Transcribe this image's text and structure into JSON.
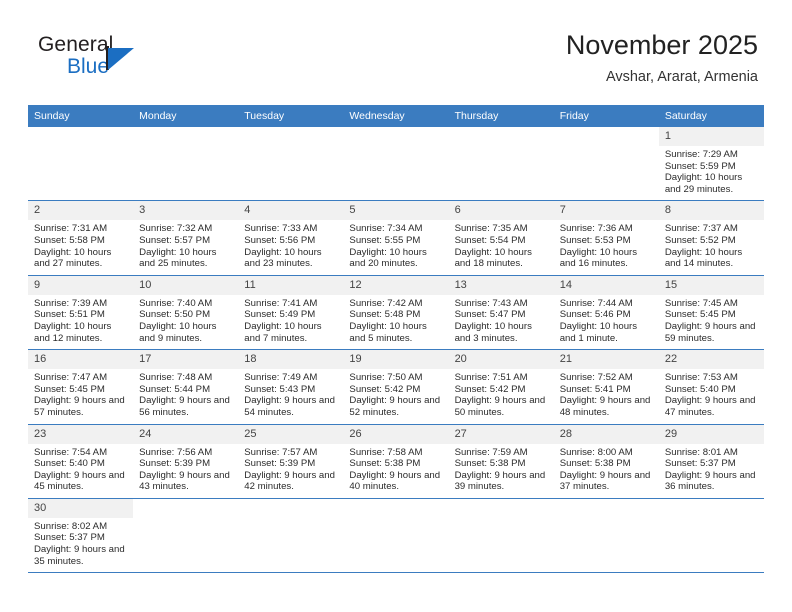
{
  "brand": {
    "line1": "General",
    "line2": "Blue",
    "mark": "triangle-logo"
  },
  "header": {
    "title": "November 2025",
    "subtitle": "Avshar, Ararat, Armenia"
  },
  "weekday_headers": [
    "Sunday",
    "Monday",
    "Tuesday",
    "Wednesday",
    "Thursday",
    "Friday",
    "Saturday"
  ],
  "labels": {
    "sunrise": "Sunrise:",
    "sunset": "Sunset:",
    "daylight": "Daylight:"
  },
  "colors": {
    "header_blue": "#3b7cc0",
    "brand_blue": "#1b6ec2",
    "daynum_bg": "#f1f1f1",
    "text": "#2b2b2b"
  },
  "weeks": [
    [
      {
        "empty": true
      },
      {
        "empty": true
      },
      {
        "empty": true
      },
      {
        "empty": true
      },
      {
        "empty": true
      },
      {
        "empty": true
      },
      {
        "day": "1",
        "sunrise": "Sunrise: 7:29 AM",
        "sunset": "Sunset: 5:59 PM",
        "daylight": "Daylight: 10 hours and 29 minutes."
      }
    ],
    [
      {
        "day": "2",
        "sunrise": "Sunrise: 7:31 AM",
        "sunset": "Sunset: 5:58 PM",
        "daylight": "Daylight: 10 hours and 27 minutes."
      },
      {
        "day": "3",
        "sunrise": "Sunrise: 7:32 AM",
        "sunset": "Sunset: 5:57 PM",
        "daylight": "Daylight: 10 hours and 25 minutes."
      },
      {
        "day": "4",
        "sunrise": "Sunrise: 7:33 AM",
        "sunset": "Sunset: 5:56 PM",
        "daylight": "Daylight: 10 hours and 23 minutes."
      },
      {
        "day": "5",
        "sunrise": "Sunrise: 7:34 AM",
        "sunset": "Sunset: 5:55 PM",
        "daylight": "Daylight: 10 hours and 20 minutes."
      },
      {
        "day": "6",
        "sunrise": "Sunrise: 7:35 AM",
        "sunset": "Sunset: 5:54 PM",
        "daylight": "Daylight: 10 hours and 18 minutes."
      },
      {
        "day": "7",
        "sunrise": "Sunrise: 7:36 AM",
        "sunset": "Sunset: 5:53 PM",
        "daylight": "Daylight: 10 hours and 16 minutes."
      },
      {
        "day": "8",
        "sunrise": "Sunrise: 7:37 AM",
        "sunset": "Sunset: 5:52 PM",
        "daylight": "Daylight: 10 hours and 14 minutes."
      }
    ],
    [
      {
        "day": "9",
        "sunrise": "Sunrise: 7:39 AM",
        "sunset": "Sunset: 5:51 PM",
        "daylight": "Daylight: 10 hours and 12 minutes."
      },
      {
        "day": "10",
        "sunrise": "Sunrise: 7:40 AM",
        "sunset": "Sunset: 5:50 PM",
        "daylight": "Daylight: 10 hours and 9 minutes."
      },
      {
        "day": "11",
        "sunrise": "Sunrise: 7:41 AM",
        "sunset": "Sunset: 5:49 PM",
        "daylight": "Daylight: 10 hours and 7 minutes."
      },
      {
        "day": "12",
        "sunrise": "Sunrise: 7:42 AM",
        "sunset": "Sunset: 5:48 PM",
        "daylight": "Daylight: 10 hours and 5 minutes."
      },
      {
        "day": "13",
        "sunrise": "Sunrise: 7:43 AM",
        "sunset": "Sunset: 5:47 PM",
        "daylight": "Daylight: 10 hours and 3 minutes."
      },
      {
        "day": "14",
        "sunrise": "Sunrise: 7:44 AM",
        "sunset": "Sunset: 5:46 PM",
        "daylight": "Daylight: 10 hours and 1 minute."
      },
      {
        "day": "15",
        "sunrise": "Sunrise: 7:45 AM",
        "sunset": "Sunset: 5:45 PM",
        "daylight": "Daylight: 9 hours and 59 minutes."
      }
    ],
    [
      {
        "day": "16",
        "sunrise": "Sunrise: 7:47 AM",
        "sunset": "Sunset: 5:45 PM",
        "daylight": "Daylight: 9 hours and 57 minutes."
      },
      {
        "day": "17",
        "sunrise": "Sunrise: 7:48 AM",
        "sunset": "Sunset: 5:44 PM",
        "daylight": "Daylight: 9 hours and 56 minutes."
      },
      {
        "day": "18",
        "sunrise": "Sunrise: 7:49 AM",
        "sunset": "Sunset: 5:43 PM",
        "daylight": "Daylight: 9 hours and 54 minutes."
      },
      {
        "day": "19",
        "sunrise": "Sunrise: 7:50 AM",
        "sunset": "Sunset: 5:42 PM",
        "daylight": "Daylight: 9 hours and 52 minutes."
      },
      {
        "day": "20",
        "sunrise": "Sunrise: 7:51 AM",
        "sunset": "Sunset: 5:42 PM",
        "daylight": "Daylight: 9 hours and 50 minutes."
      },
      {
        "day": "21",
        "sunrise": "Sunrise: 7:52 AM",
        "sunset": "Sunset: 5:41 PM",
        "daylight": "Daylight: 9 hours and 48 minutes."
      },
      {
        "day": "22",
        "sunrise": "Sunrise: 7:53 AM",
        "sunset": "Sunset: 5:40 PM",
        "daylight": "Daylight: 9 hours and 47 minutes."
      }
    ],
    [
      {
        "day": "23",
        "sunrise": "Sunrise: 7:54 AM",
        "sunset": "Sunset: 5:40 PM",
        "daylight": "Daylight: 9 hours and 45 minutes."
      },
      {
        "day": "24",
        "sunrise": "Sunrise: 7:56 AM",
        "sunset": "Sunset: 5:39 PM",
        "daylight": "Daylight: 9 hours and 43 minutes."
      },
      {
        "day": "25",
        "sunrise": "Sunrise: 7:57 AM",
        "sunset": "Sunset: 5:39 PM",
        "daylight": "Daylight: 9 hours and 42 minutes."
      },
      {
        "day": "26",
        "sunrise": "Sunrise: 7:58 AM",
        "sunset": "Sunset: 5:38 PM",
        "daylight": "Daylight: 9 hours and 40 minutes."
      },
      {
        "day": "27",
        "sunrise": "Sunrise: 7:59 AM",
        "sunset": "Sunset: 5:38 PM",
        "daylight": "Daylight: 9 hours and 39 minutes."
      },
      {
        "day": "28",
        "sunrise": "Sunrise: 8:00 AM",
        "sunset": "Sunset: 5:38 PM",
        "daylight": "Daylight: 9 hours and 37 minutes."
      },
      {
        "day": "29",
        "sunrise": "Sunrise: 8:01 AM",
        "sunset": "Sunset: 5:37 PM",
        "daylight": "Daylight: 9 hours and 36 minutes."
      }
    ],
    [
      {
        "day": "30",
        "sunrise": "Sunrise: 8:02 AM",
        "sunset": "Sunset: 5:37 PM",
        "daylight": "Daylight: 9 hours and 35 minutes."
      },
      {
        "empty": true
      },
      {
        "empty": true
      },
      {
        "empty": true
      },
      {
        "empty": true
      },
      {
        "empty": true
      },
      {
        "empty": true
      }
    ]
  ]
}
